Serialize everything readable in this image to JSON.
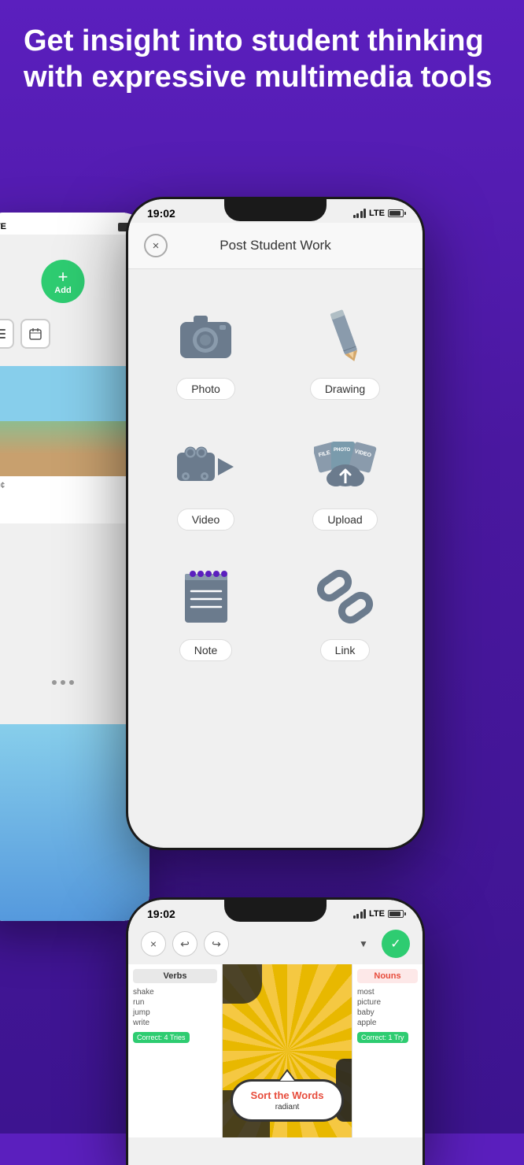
{
  "background": {
    "color": "#5b1fbe"
  },
  "header": {
    "text": "Get insight into student thinking with expressive multimedia tools"
  },
  "phone_left": {
    "status": {
      "lte": "LTE",
      "battery": "full"
    },
    "add_button_label": "Add",
    "add_button_plus": "+"
  },
  "phone_main": {
    "status": {
      "time": "19:02",
      "signal": "LTE",
      "battery": "full"
    },
    "modal_title": "Post Student Work",
    "close_label": "×",
    "options": [
      {
        "id": "photo",
        "label": "Photo"
      },
      {
        "id": "drawing",
        "label": "Drawing"
      },
      {
        "id": "video",
        "label": "Video"
      },
      {
        "id": "upload",
        "label": "Upload"
      },
      {
        "id": "note",
        "label": "Note"
      },
      {
        "id": "link",
        "label": "Link"
      }
    ]
  },
  "phone_bottom": {
    "status": {
      "time": "19:02",
      "signal": "LTE",
      "battery": "full"
    },
    "toolbar": {
      "close_label": "×",
      "undo_label": "↩",
      "redo_label": "↪",
      "check_label": "✓"
    },
    "game": {
      "verbs_title": "Verbs",
      "verbs_words": [
        "shake",
        "run",
        "jump",
        "write"
      ],
      "correct_verbs": "Correct: 4 Tries",
      "nouns_title": "Nouns",
      "nouns_words": [
        "most",
        "picture",
        "baby",
        "apple"
      ],
      "correct_nouns": "Correct: 1 Try",
      "sort_title": "Sort the Words",
      "sort_subtitle": "radiant"
    }
  }
}
